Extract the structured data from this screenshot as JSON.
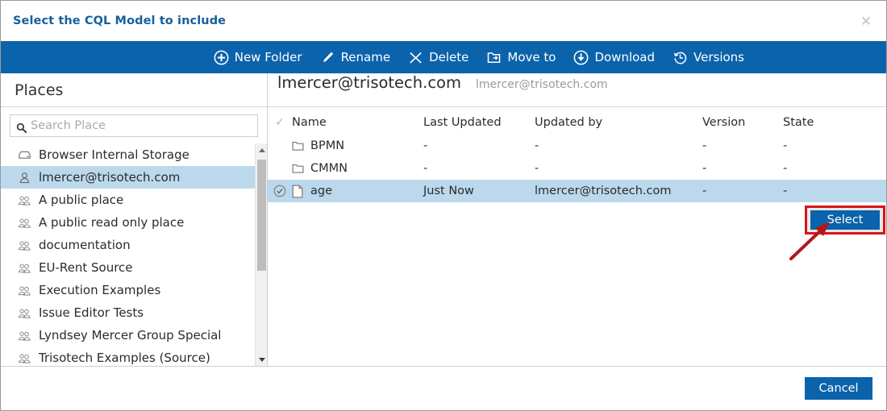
{
  "dialog": {
    "title": "Select the CQL Model to include",
    "close_label": "✕"
  },
  "toolbar": {
    "items": [
      {
        "label": "New Folder",
        "icon": "plus-circle-icon"
      },
      {
        "label": "Rename",
        "icon": "pencil-icon"
      },
      {
        "label": "Delete",
        "icon": "x-icon"
      },
      {
        "label": "Move to",
        "icon": "move-folder-icon"
      },
      {
        "label": "Download",
        "icon": "download-circle-icon"
      },
      {
        "label": "Versions",
        "icon": "history-icon"
      }
    ]
  },
  "sidebar": {
    "heading": "Places",
    "search": {
      "placeholder": "Search Place",
      "value": "",
      "icon": "search-icon"
    },
    "items": [
      {
        "label": "Browser Internal Storage",
        "icon": "drive-icon",
        "selected": false
      },
      {
        "label": "lmercer@trisotech.com",
        "icon": "user-icon",
        "selected": true
      },
      {
        "label": "A public place",
        "icon": "group-icon",
        "selected": false
      },
      {
        "label": "A public read only place",
        "icon": "group-icon",
        "selected": false
      },
      {
        "label": "documentation",
        "icon": "group-icon",
        "selected": false
      },
      {
        "label": "EU-Rent Source",
        "icon": "group-icon",
        "selected": false
      },
      {
        "label": "Execution Examples",
        "icon": "group-icon",
        "selected": false
      },
      {
        "label": "Issue Editor Tests",
        "icon": "group-icon",
        "selected": false
      },
      {
        "label": "Lyndsey Mercer Group Special",
        "icon": "group-icon",
        "selected": false
      },
      {
        "label": "Trisotech Examples (Source)",
        "icon": "group-icon",
        "selected": false
      }
    ]
  },
  "main": {
    "title": "lmercer@trisotech.com",
    "breadcrumb": "lmercer@trisotech.com",
    "columns": {
      "check": "✓",
      "name": "Name",
      "last_updated": "Last Updated",
      "updated_by": "Updated by",
      "version": "Version",
      "state": "State"
    },
    "rows": [
      {
        "icon": "folder-icon",
        "name": "BPMN",
        "last_updated": "-",
        "updated_by": "-",
        "version": "-",
        "state": "-",
        "selected": false
      },
      {
        "icon": "folder-icon",
        "name": "CMMN",
        "last_updated": "-",
        "updated_by": "-",
        "version": "-",
        "state": "-",
        "selected": false
      },
      {
        "icon": "document-icon",
        "name": "age",
        "last_updated": "Just Now",
        "updated_by": "lmercer@trisotech.com",
        "version": "-",
        "state": "-",
        "selected": true
      }
    ],
    "select_button": "Select"
  },
  "footer": {
    "cancel": "Cancel"
  },
  "colors": {
    "brand_blue": "#0b63ab",
    "title_blue": "#17609e",
    "row_selected": "#bcd8ed",
    "annotation_red": "#d81616"
  }
}
